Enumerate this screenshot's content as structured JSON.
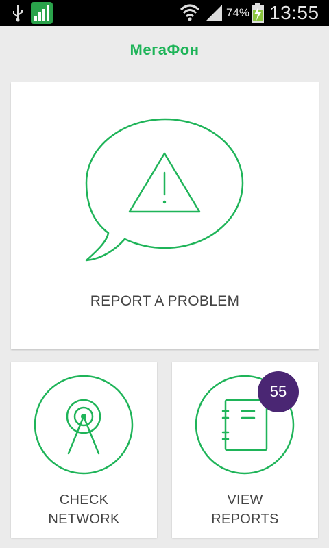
{
  "status_bar": {
    "battery_percent": "74%",
    "time": "13:55",
    "icons": [
      "usb-icon",
      "signal-app-icon",
      "wifi-icon",
      "cell-signal-icon",
      "battery-charging-icon"
    ]
  },
  "header": {
    "brand": "МегаФон"
  },
  "cards": {
    "report": {
      "label": "REPORT A PROBLEM",
      "icon": "speech-bubble-warning-icon"
    },
    "check": {
      "label_line1": "CHECK",
      "label_line2": "NETWORK",
      "icon": "antenna-icon"
    },
    "view": {
      "label_line1": "VIEW",
      "label_line2": "REPORTS",
      "icon": "notebook-icon",
      "badge_count": "55"
    }
  },
  "colors": {
    "accent": "#1fb459",
    "badge": "#4a2673",
    "background": "#ebebeb",
    "card": "#ffffff"
  }
}
